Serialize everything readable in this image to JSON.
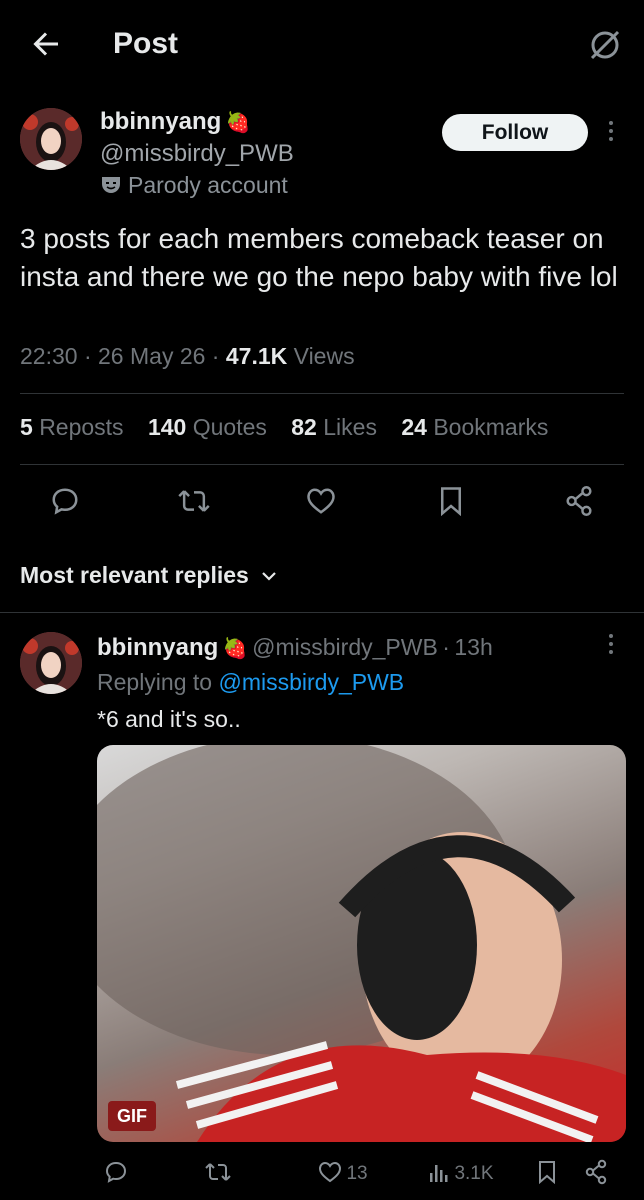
{
  "header": {
    "title": "Post"
  },
  "post": {
    "display_name": "bbinnyang",
    "handle": "@missbirdy_PWB",
    "badge_label": "Parody account",
    "follow_label": "Follow",
    "text": "3 posts for each members comeback teaser on insta and there we go the nepo baby with five lol",
    "time": "22:30",
    "date": "26 May 26",
    "views_count": "47.1K",
    "views_label": "Views",
    "stats": [
      {
        "count": "5",
        "label": "Reposts"
      },
      {
        "count": "140",
        "label": "Quotes"
      },
      {
        "count": "82",
        "label": "Likes"
      },
      {
        "count": "24",
        "label": "Bookmarks"
      }
    ]
  },
  "replies": {
    "sort_label": "Most relevant replies",
    "items": [
      {
        "display_name": "bbinnyang",
        "handle": "@missbirdy_PWB",
        "age": "13h",
        "replying_prefix": "Replying to",
        "replying_handle": "@missbirdy_PWB",
        "text": "*6 and it's so..",
        "media_badge": "GIF",
        "likes": "13",
        "views": "3.1K"
      }
    ]
  },
  "colors": {
    "background": "#000000",
    "text": "#e7e9ea",
    "muted": "#71767b",
    "link": "#1d9bf0",
    "divider": "#2f3336"
  }
}
